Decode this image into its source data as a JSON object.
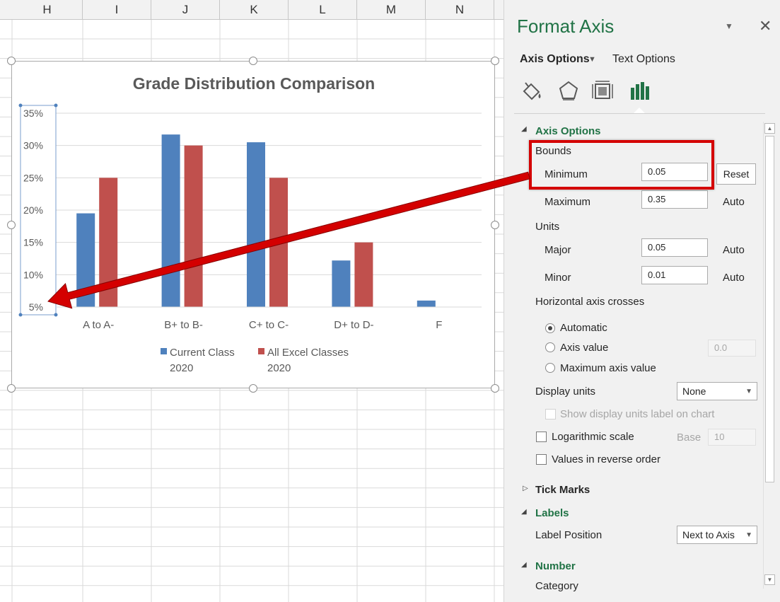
{
  "sheet": {
    "columns": [
      "H",
      "I",
      "J",
      "K",
      "L",
      "M",
      "N"
    ]
  },
  "chart_data": {
    "type": "bar",
    "title": "Grade Distribution Comparison",
    "categories": [
      "A to A-",
      "B+ to B-",
      "C+ to C-",
      "D+ to D-",
      "F"
    ],
    "series": [
      {
        "name": "Current  Class 2020",
        "name_lines": [
          "Current  Class",
          "2020"
        ],
        "color": "#4f81bd",
        "values": [
          0.195,
          0.317,
          0.305,
          0.122,
          0.06
        ]
      },
      {
        "name": "All Excel Classes 2020",
        "name_lines": [
          "All Excel Classes",
          "2020"
        ],
        "color": "#c0504d",
        "values": [
          0.25,
          0.3,
          0.25,
          0.15,
          0.05
        ]
      }
    ],
    "y_tick_labels": [
      "35%",
      "30%",
      "25%",
      "20%",
      "15%",
      "10%",
      "5%"
    ],
    "ylim": [
      0.05,
      0.35
    ],
    "y_tick_step": 0.05,
    "grid": true,
    "legend_position": "bottom",
    "xlabel": "",
    "ylabel": ""
  },
  "pane": {
    "title": "Format Axis",
    "collapse_glyph": "▼",
    "close_glyph": "✕",
    "tabs": {
      "axis_options": "Axis Options",
      "text_options": "Text Options",
      "caret": "▼"
    },
    "tab_icons": [
      "fill-line-icon",
      "effects-icon",
      "size-properties-icon",
      "axis-options-icon"
    ],
    "axis_options_heading": "Axis Options",
    "bounds_label": "Bounds",
    "minimum_label": "Minimum",
    "minimum_value": "0.05",
    "reset_label": "Reset",
    "maximum_label": "Maximum",
    "maximum_value": "0.35",
    "maximum_auto": "Auto",
    "units_label": "Units",
    "major_label": "Major",
    "major_value": "0.05",
    "major_auto": "Auto",
    "minor_label": "Minor",
    "minor_value": "0.01",
    "minor_auto": "Auto",
    "crosses_label": "Horizontal axis crosses",
    "crosses_options": [
      "Automatic",
      "Axis value",
      "Maximum axis value"
    ],
    "crosses_selected": "Automatic",
    "axis_value_field": "0.0",
    "display_units_label": "Display units",
    "display_units_value": "None",
    "show_units_label": "Show display units label on chart",
    "log_scale_label": "Logarithmic scale",
    "base_label": "Base",
    "base_value": "10",
    "reverse_label": "Values in reverse order",
    "tick_marks_heading": "Tick Marks",
    "labels_heading": "Labels",
    "label_position_label": "Label Position",
    "label_position_value": "Next to Axis",
    "number_heading": "Number",
    "category_label": "Category"
  },
  "colors": {
    "accent_green": "#217346",
    "annotation_red": "#d40000",
    "series_blue": "#4f81bd",
    "series_red": "#c0504d"
  }
}
